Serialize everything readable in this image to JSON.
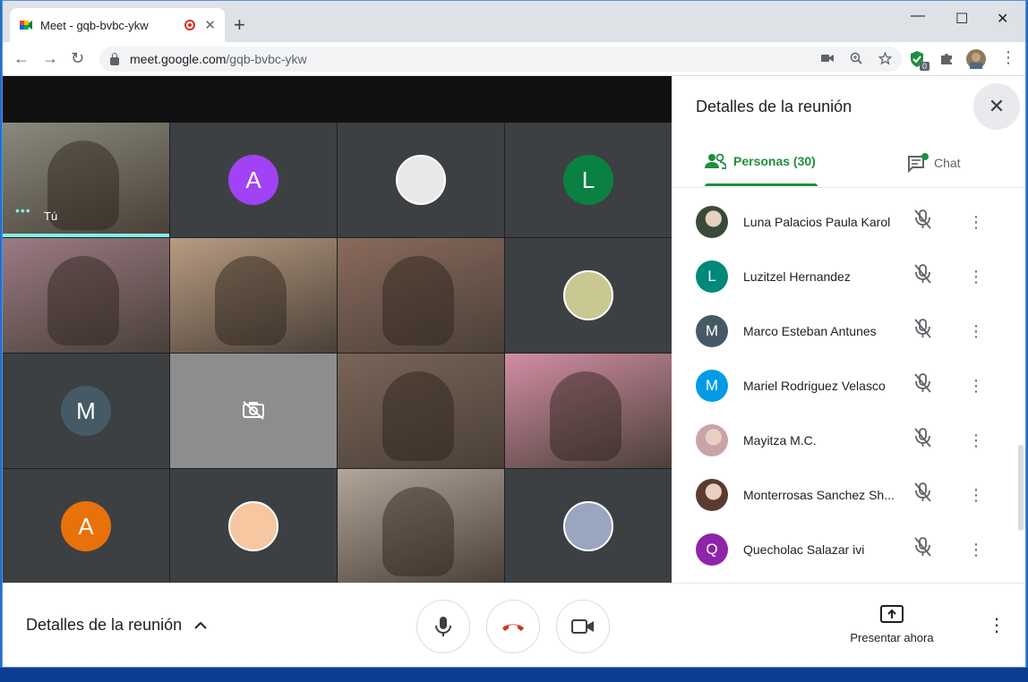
{
  "browser": {
    "tab_title": "Meet - gqb-bvbc-ykw",
    "url_host": "meet.google.com",
    "url_path": "/gqb-bvbc-ykw",
    "new_tab": "+",
    "close_tab": "✕",
    "minimize": "—",
    "maximize": "☐",
    "close_window": "✕",
    "back": "←",
    "forward": "→",
    "reload": "↻",
    "extension_badge": "0"
  },
  "grid": {
    "self_label": "Tú",
    "self_dots": "•••",
    "tiles": [
      {
        "kind": "video",
        "name": "self-video",
        "color": "#8a8a7c"
      },
      {
        "kind": "initial",
        "letter": "A",
        "color": "#a142f4"
      },
      {
        "kind": "image",
        "color": "#e8e8e8"
      },
      {
        "kind": "initial",
        "letter": "L",
        "color": "#0b8043"
      },
      {
        "kind": "video",
        "color": "#9b7a84"
      },
      {
        "kind": "video",
        "color": "#b89c82"
      },
      {
        "kind": "video",
        "color": "#8a6a5c"
      },
      {
        "kind": "image",
        "color": "#c8c890"
      },
      {
        "kind": "initial",
        "letter": "M",
        "color": "#455a64"
      },
      {
        "kind": "camera-off",
        "color": "#8d8d8d"
      },
      {
        "kind": "video",
        "color": "#7a6458"
      },
      {
        "kind": "video",
        "color": "#d28da4"
      },
      {
        "kind": "initial",
        "letter": "A",
        "color": "#e8710a"
      },
      {
        "kind": "image",
        "color": "#f6c7a0"
      },
      {
        "kind": "video",
        "color": "#b3a59a"
      },
      {
        "kind": "image",
        "color": "#9aa5c0"
      }
    ]
  },
  "sidebar": {
    "title": "Detalles de la reunión",
    "close": "✕",
    "tabs": {
      "people": "Personas (30)",
      "chat": "Chat"
    },
    "people": [
      {
        "name": "Luna Palacios Paula Karol",
        "avatar_type": "photo",
        "color": "#3a4a3a"
      },
      {
        "name": "Luzitzel Hernandez",
        "avatar_type": "initial",
        "letter": "L",
        "color": "#00897b"
      },
      {
        "name": "Marco Esteban Antunes",
        "avatar_type": "initial",
        "letter": "M",
        "color": "#455a64"
      },
      {
        "name": "Mariel Rodriguez Velasco",
        "avatar_type": "initial",
        "letter": "M",
        "color": "#039be5"
      },
      {
        "name": "Mayitza M.C.",
        "avatar_type": "photo",
        "color": "#c9a3a8"
      },
      {
        "name": "Monterrosas Sanchez Sh...",
        "avatar_type": "photo",
        "color": "#5b3b30"
      },
      {
        "name": "Quecholac Salazar ivi",
        "avatar_type": "initial",
        "letter": "Q",
        "color": "#8e24aa"
      }
    ]
  },
  "bottombar": {
    "meeting_details": "Detalles de la reunión",
    "present": "Presentar ahora"
  }
}
